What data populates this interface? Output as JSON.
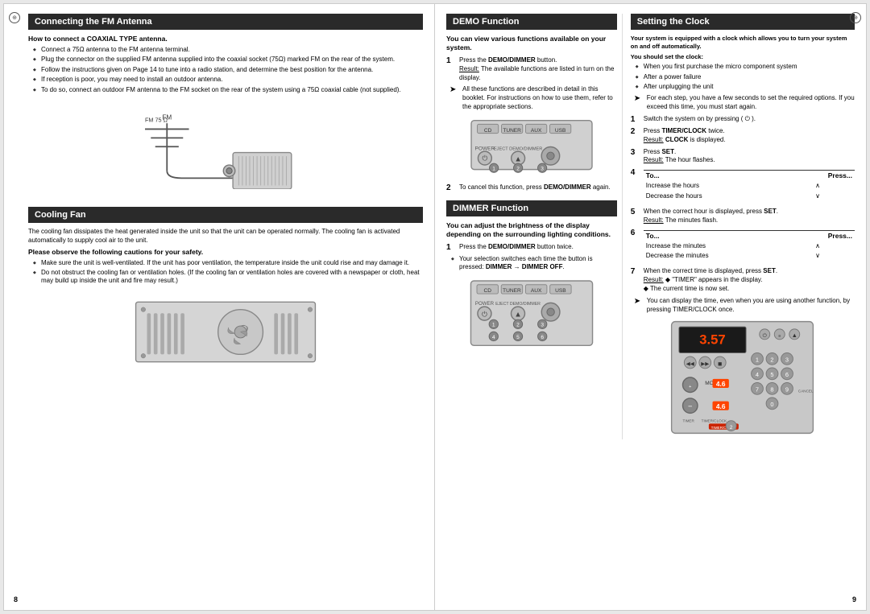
{
  "left": {
    "fm_section": {
      "title": "Connecting the FM Antenna",
      "subtitle": "How to connect a COAXIAL TYPE antenna.",
      "bullets": [
        "Connect a 75Ω antenna to the FM antenna terminal.",
        "Plug the connector on the supplied FM antenna supplied into the coaxial socket (75Ω) marked FM on the rear of the system.",
        "Follow the instructions given on Page 14 to tune into a radio station, and determine the best position for the antenna.",
        "If reception is poor, you may need to install an outdoor antenna.",
        "To do so, connect an outdoor FM antenna to the FM socket on the rear of the system using a 75Ω coaxial cable (not supplied)."
      ],
      "fm_label": "FM 75 Ω"
    },
    "cooling_section": {
      "title": "Cooling Fan",
      "intro": "The cooling fan dissipates the heat generated inside the unit so that the unit can be operated normally. The cooling fan is activated automatically to supply cool air to the unit.",
      "safety_title": "Please observe the following cautions for your safety.",
      "safety_bullets": [
        "Make sure the unit is well-ventilated. If the unit has poor ventilation, the temperature inside the unit could rise and may damage it.",
        "Do not obstruct the cooling fan or ventilation holes. (If the cooling fan or ventilation holes are covered with a newspaper or cloth, heat may build up inside the unit and fire may result.)"
      ]
    },
    "page_num": "8"
  },
  "right": {
    "demo_section": {
      "title": "DEMO Function",
      "intro": "You can view  various functions available on your system.",
      "steps": [
        {
          "num": "1",
          "text": "Press the DEMO/DIMMER button.",
          "result_label": "Result:",
          "result_text": "The available functions are listed in turn on the display."
        }
      ],
      "arrow_note": "All these functions are described in detail in this booklet. For instructions on how to use them, refer to the appropriate sections.",
      "step2_num": "2",
      "step2_text": "To cancel this function, press DEMO/DIMMER again."
    },
    "dimmer_section": {
      "title": "DIMMER Function",
      "intro": "You can adjust the brightness of the display depending on the surrounding lighting conditions.",
      "steps": [
        {
          "num": "1",
          "text": "Press the DEMO/DIMMER button twice."
        }
      ],
      "bullet_note": "Your selection switches each time the button is pressed: DIMMER → DIMMER OFF."
    },
    "clock_section": {
      "title": "Setting the Clock",
      "intro": "Your system is equipped with a clock which allows you to turn your system on and off automatically.",
      "should_set": "You should set the clock:",
      "clock_bullets": [
        "When you first purchase the micro component system",
        "After a power failure",
        "After unplugging the unit"
      ],
      "arrow_note": "For each step, you have a few seconds to set the required options. If you exceed this time, you must start again.",
      "steps": [
        {
          "num": "1",
          "text": "Switch the system on by pressing (  )."
        },
        {
          "num": "2",
          "text": "Press TIMER/CLOCK twice.",
          "result_label": "Result:",
          "result_text": "CLOCK is displayed."
        },
        {
          "num": "3",
          "text": "Press SET.",
          "result_label": "Result:",
          "result_text": "The hour flashes."
        },
        {
          "num": "4",
          "to_label": "To...",
          "press_label": "Press...",
          "rows": [
            {
              "to": "Increase the hours",
              "press": "∧"
            },
            {
              "to": "Decrease the hours",
              "press": "∨"
            }
          ]
        },
        {
          "num": "5",
          "text": "When the correct hour is displayed, press SET.",
          "result_label": "Result:",
          "result_text": "The minutes flash."
        },
        {
          "num": "6",
          "to_label": "To...",
          "press_label": "Press...",
          "rows": [
            {
              "to": "Increase the minutes",
              "press": "∧"
            },
            {
              "to": "Decrease the minutes",
              "press": "∨"
            }
          ]
        },
        {
          "num": "7",
          "text": "When the correct time is displayed, press SET.",
          "result_label": "Result:",
          "result_text": "• \"TIMER\" appears in the display.",
          "extra": "The current time is now set."
        }
      ],
      "arrow_note2": "You can display the time, even when you are using another function, by pressing TIMER/CLOCK once."
    },
    "page_num": "9"
  }
}
